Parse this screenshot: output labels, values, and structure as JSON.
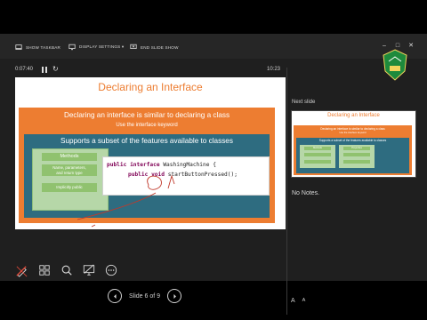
{
  "toolbar": {
    "show_taskbar": "SHOW TASKBAR",
    "display_settings": "DISPLAY SETTINGS ▾",
    "end_slide_show": "END SLIDE SHOW"
  },
  "timer": {
    "elapsed": "0:07:40",
    "clock": "10:23"
  },
  "slide": {
    "title": "Declaring an Interface",
    "line1": "Declaring an interface is similar to declaring a class",
    "line2": "Use the interface keyword",
    "teal_line": "Supports a subset of the features available to classes",
    "methods_head": "Methods",
    "methods_row1": "Name, parameters,",
    "methods_row1b": "and return type",
    "methods_row2": "Implicitly public",
    "code_line1_kw": "public interface",
    "code_line1_rest": " WashingMachine {",
    "code_line2_kw": "public void",
    "code_line2_rest": " startButtonPressed();"
  },
  "nav": {
    "counter": "Slide 6 of 9"
  },
  "next_slide": {
    "label": "Next slide",
    "title": "Declaring an Interface",
    "line1": "Declaring an interface is similar to declaring a class",
    "line2": "Use the interface keyword",
    "teal_line": "Supports a subset of the features available to classes",
    "card1_head": "Methods",
    "card2_head": "Properties"
  },
  "notes": "No Notes.",
  "font_buttons": [
    "A",
    "A"
  ],
  "colors": {
    "accent": "#ed7d31",
    "teal": "#2e6c80",
    "green": "#90c26f"
  }
}
